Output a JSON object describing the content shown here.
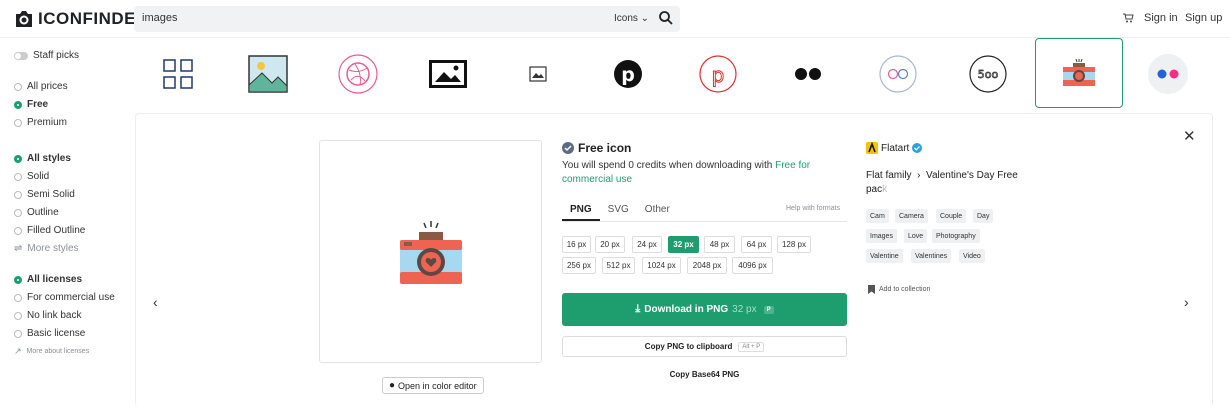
{
  "header": {
    "logo": "ICONFINDER",
    "search_value": "images",
    "search_type": "Icons",
    "signin": "Sign in",
    "signup": "Sign up"
  },
  "sidebar": {
    "staff_picks": "Staff picks",
    "prices": [
      "All prices",
      "Free",
      "Premium"
    ],
    "styles": [
      "All styles",
      "Solid",
      "Semi Solid",
      "Outline",
      "Filled Outline"
    ],
    "more_styles": "More styles",
    "licenses": [
      "All licenses",
      "For commercial use",
      "No link back",
      "Basic license"
    ],
    "more_licenses": "More about licenses"
  },
  "detail": {
    "title": "Free icon",
    "credits_text": "You will spend 0 credits when downloading with ",
    "credits_link": "Free for commercial use",
    "tabs": [
      "PNG",
      "SVG",
      "Other"
    ],
    "help": "Help with formats",
    "sizes": [
      "16 px",
      "20 px",
      "24 px",
      "32 px",
      "48 px",
      "64 px",
      "128 px",
      "256 px",
      "512 px",
      "1024 px",
      "2048 px",
      "4096 px"
    ],
    "selected_size": "32 px",
    "download_label": "Download in PNG",
    "download_px": "32 px",
    "download_key": "P",
    "copy_png": "Copy PNG to clipboard",
    "copy_png_key": "Alt + P",
    "copy_b64": "Copy Base64 PNG",
    "color_editor": "Open in color editor"
  },
  "author": {
    "name": "Flatart",
    "family": "Flat family",
    "pack_a": "Valentine's Day Free pac",
    "pack_b": "k",
    "tags": [
      "Cam",
      "Camera",
      "Couple",
      "Day",
      "Images",
      "Love",
      "Photography",
      "Valentine",
      "Valentines",
      "Video"
    ],
    "add_collection": "Add to collection"
  },
  "colors": {
    "accent": "#1e9e6f",
    "pink": "#e85d8a",
    "camera_blue": "#a7d8f0",
    "camera_red": "#ee6352"
  }
}
